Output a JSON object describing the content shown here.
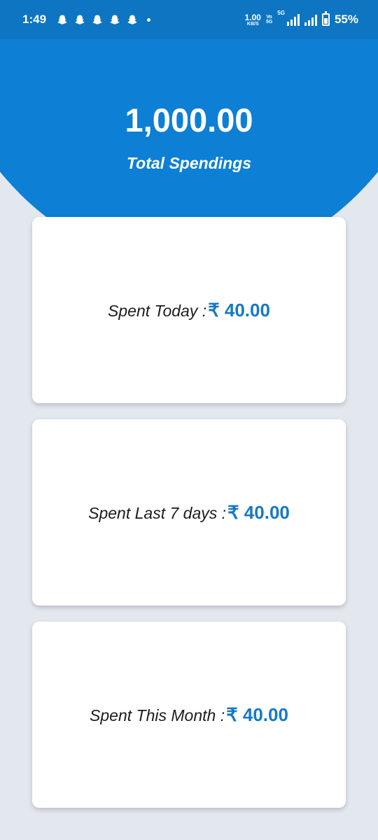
{
  "status_bar": {
    "time": "1:49",
    "notification_icons": [
      "snapchat-icon",
      "snapchat-icon",
      "snapchat-icon",
      "snapchat-icon",
      "snapchat-icon"
    ],
    "net_speed_value": "1.00",
    "net_speed_unit": "KB/S",
    "volte_top": "Vo",
    "volte_bottom": "5G",
    "network_type": "5G",
    "battery_percent": "55%"
  },
  "summary": {
    "total_amount": "1,000.00",
    "total_label": "Total Spendings"
  },
  "cards": [
    {
      "label": "Spent Today :",
      "value": "₹ 40.00"
    },
    {
      "label": "Spent Last 7 days :",
      "value": "₹ 40.00"
    },
    {
      "label": "Spent This Month :",
      "value": "₹ 40.00"
    }
  ],
  "colors": {
    "header_blue": "#0d7fd5",
    "status_blue": "#0d75c2",
    "accent_value": "#1579c8",
    "background": "#e3e7ee",
    "card": "#ffffff"
  }
}
